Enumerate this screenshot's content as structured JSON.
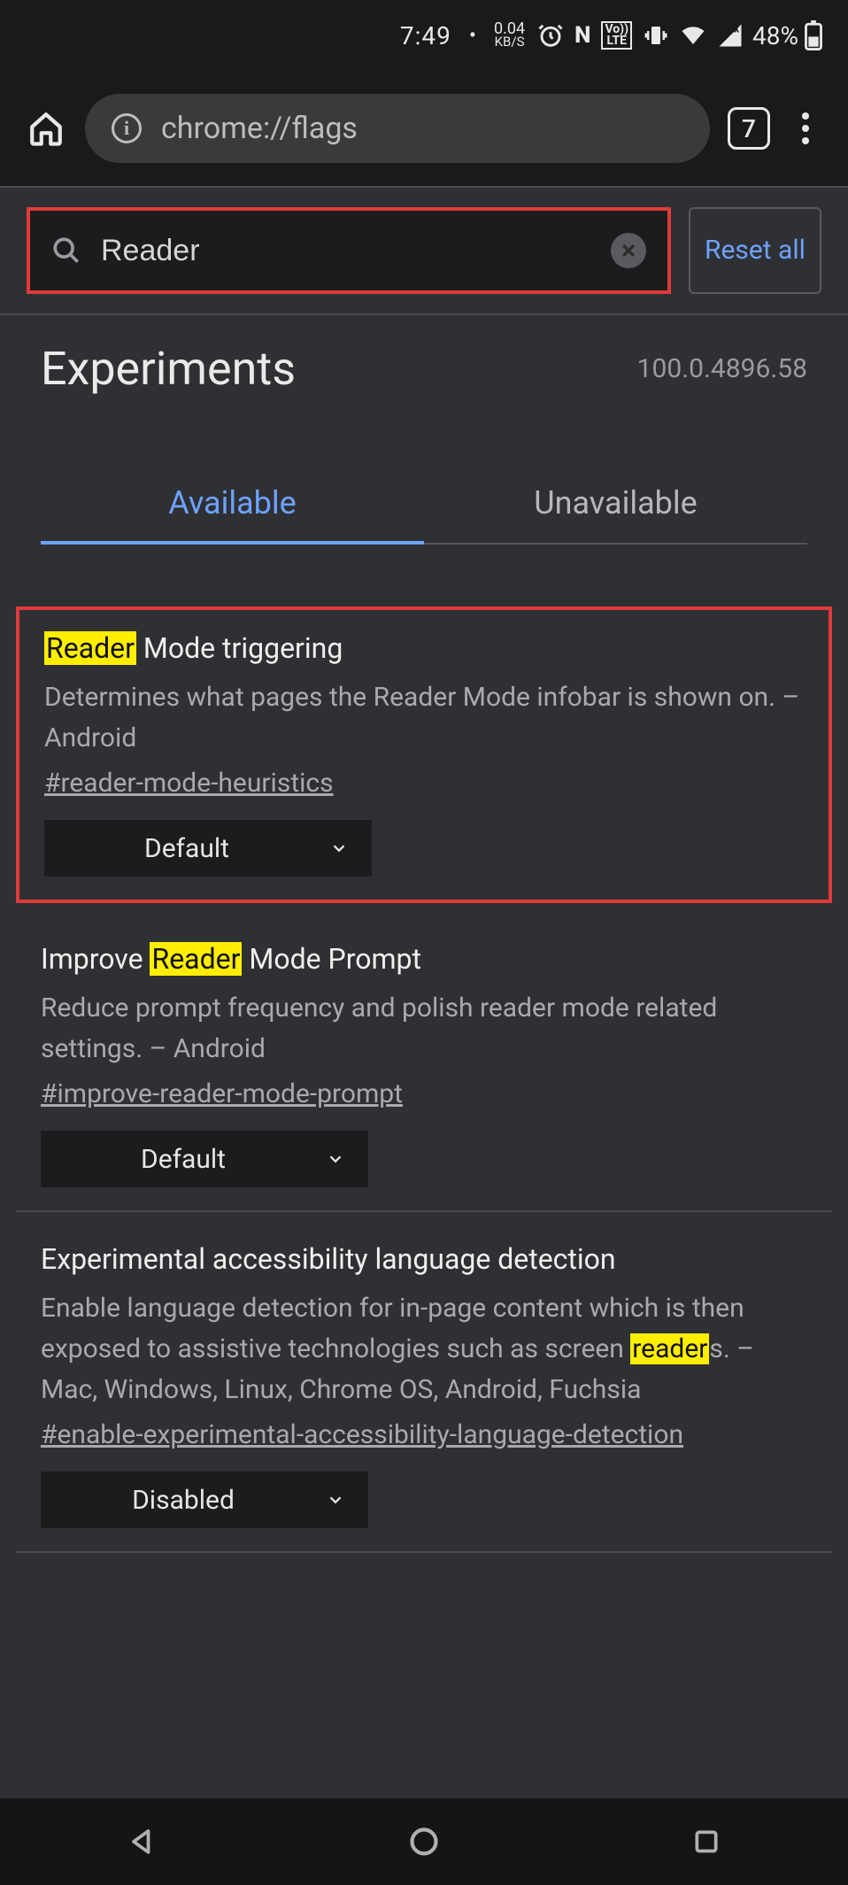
{
  "status": {
    "time": "7:49",
    "net_speed_top": "0.04",
    "net_speed_bottom": "KB/S",
    "battery": "48%"
  },
  "browser": {
    "url": "chrome://flags",
    "tab_count": "7"
  },
  "search": {
    "value": "Reader",
    "reset_label": "Reset all"
  },
  "header": {
    "title": "Experiments",
    "version": "100.0.4896.58"
  },
  "tabs": {
    "available": "Available",
    "unavailable": "Unavailable"
  },
  "flags": [
    {
      "title_pre_hl": "",
      "title_hl": "Reader",
      "title_post_hl": " Mode triggering",
      "desc": "Determines what pages the Reader Mode infobar is shown on. – Android",
      "anchor": "#reader-mode-heuristics",
      "select_value": "Default",
      "boxed": true
    },
    {
      "title_pre_hl": "Improve ",
      "title_hl": "Reader",
      "title_post_hl": " Mode Prompt",
      "desc": "Reduce prompt frequency and polish reader mode related settings. – Android",
      "anchor": "#improve-reader-mode-prompt",
      "select_value": "Default",
      "boxed": false
    },
    {
      "title_pre_hl": "Experimental accessibility language detection",
      "title_hl": "",
      "title_post_hl": "",
      "desc_pre_hl": "Enable language detection for in-page content which is then exposed to assistive technologies such as screen ",
      "desc_hl": "reader",
      "desc_post_hl": "s. – Mac, Windows, Linux, Chrome OS, Android, Fuchsia",
      "anchor": "#enable-experimental-accessibility-language-detection",
      "select_value": "Disabled",
      "boxed": false
    }
  ]
}
